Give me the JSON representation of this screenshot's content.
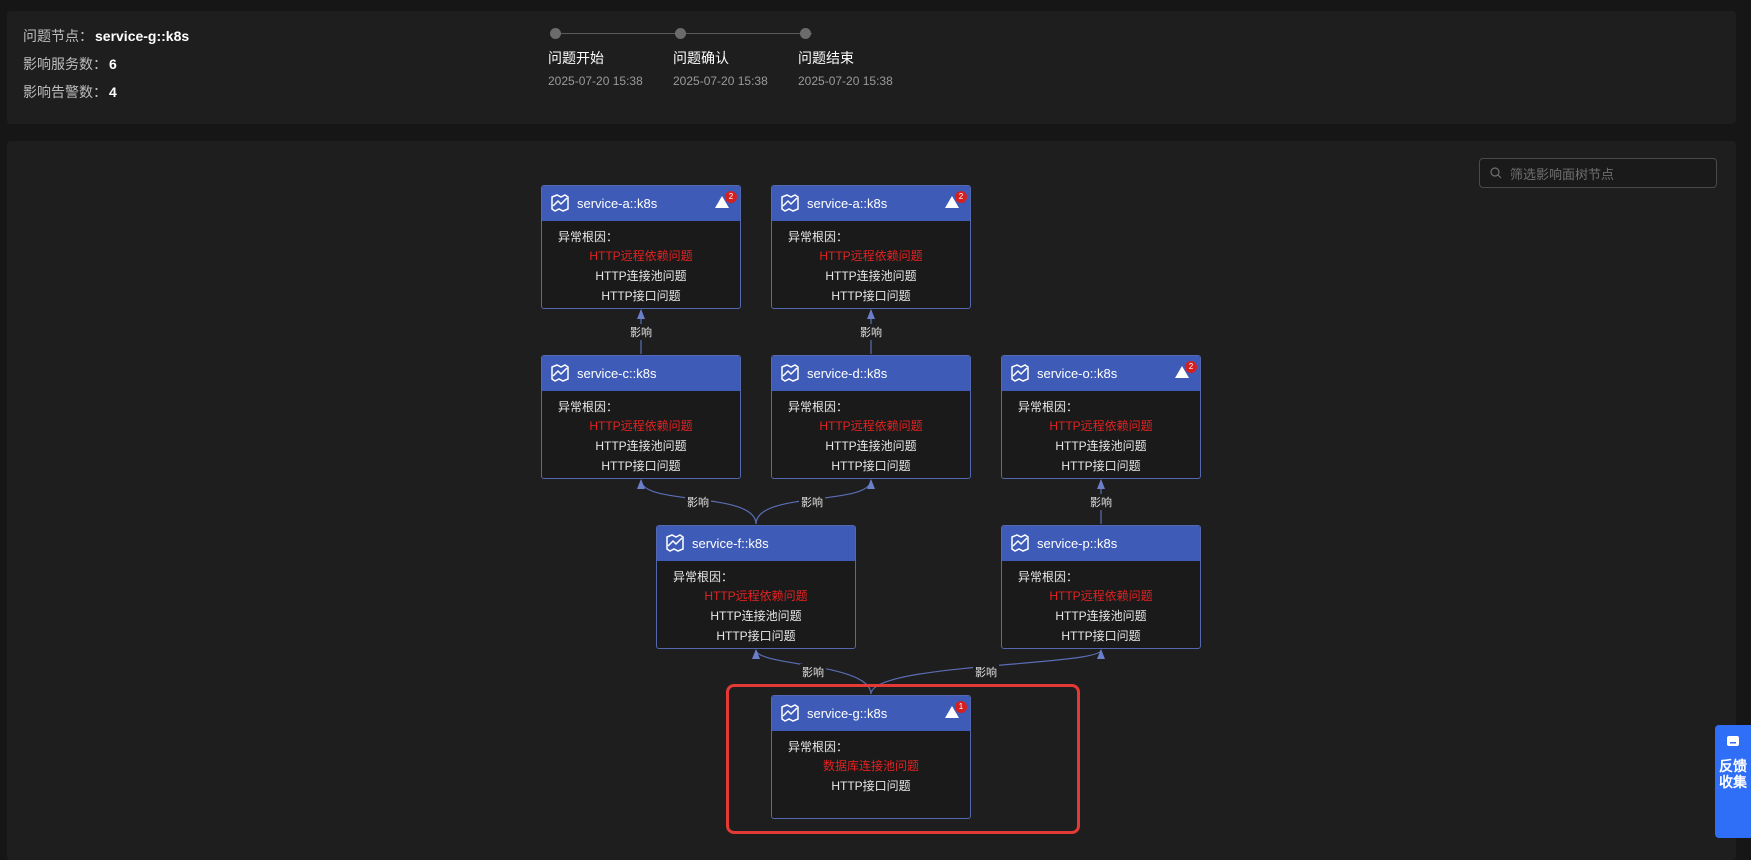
{
  "summary": {
    "problem_node_label": "问题节点：",
    "problem_node_value": "service-g::k8s",
    "affected_services_label": "影响服务数：",
    "affected_services_value": "6",
    "affected_alerts_label": "影响告警数：",
    "affected_alerts_value": "4"
  },
  "timeline": [
    {
      "label": "问题开始",
      "time": "2025-07-20 15:38"
    },
    {
      "label": "问题确认",
      "time": "2025-07-20 15:38"
    },
    {
      "label": "问题结束",
      "time": "2025-07-20 15:38"
    }
  ],
  "search": {
    "placeholder": "筛选影响面树节点"
  },
  "cause_title": "异常根因：",
  "edge_label": "影响",
  "nodes": [
    {
      "title": "service-a::k8s",
      "alerts": "2",
      "causes": [
        {
          "text": "HTTP远程依赖问题",
          "severity": "critical"
        },
        {
          "text": "HTTP连接池问题"
        },
        {
          "text": "HTTP接口问题"
        }
      ]
    },
    {
      "title": "service-a::k8s",
      "alerts": "2",
      "causes": [
        {
          "text": "HTTP远程依赖问题",
          "severity": "critical"
        },
        {
          "text": "HTTP连接池问题"
        },
        {
          "text": "HTTP接口问题"
        }
      ]
    },
    {
      "title": "service-c::k8s",
      "causes": [
        {
          "text": "HTTP远程依赖问题",
          "severity": "critical"
        },
        {
          "text": "HTTP连接池问题"
        },
        {
          "text": "HTTP接口问题"
        }
      ]
    },
    {
      "title": "service-d::k8s",
      "causes": [
        {
          "text": "HTTP远程依赖问题",
          "severity": "critical"
        },
        {
          "text": "HTTP连接池问题"
        },
        {
          "text": "HTTP接口问题"
        }
      ]
    },
    {
      "title": "service-o::k8s",
      "alerts": "2",
      "causes": [
        {
          "text": "HTTP远程依赖问题",
          "severity": "critical"
        },
        {
          "text": "HTTP连接池问题"
        },
        {
          "text": "HTTP接口问题"
        }
      ]
    },
    {
      "title": "service-f::k8s",
      "causes": [
        {
          "text": "HTTP远程依赖问题",
          "severity": "critical"
        },
        {
          "text": "HTTP连接池问题"
        },
        {
          "text": "HTTP接口问题"
        }
      ]
    },
    {
      "title": "service-p::k8s",
      "causes": [
        {
          "text": "HTTP远程依赖问题",
          "severity": "critical"
        },
        {
          "text": "HTTP连接池问题"
        },
        {
          "text": "HTTP接口问题"
        }
      ]
    },
    {
      "title": "service-g::k8s",
      "alerts": "1",
      "highlighted": true,
      "causes": [
        {
          "text": "数据库连接池问题",
          "severity": "critical"
        },
        {
          "text": "HTTP接口问题"
        }
      ]
    }
  ],
  "feedback": {
    "label": "反馈收集"
  },
  "colors": {
    "node_header": "#3f5bb8",
    "critical_text": "#e32222",
    "highlight_border": "#e53935",
    "feedback_button": "#2f6ef6"
  }
}
